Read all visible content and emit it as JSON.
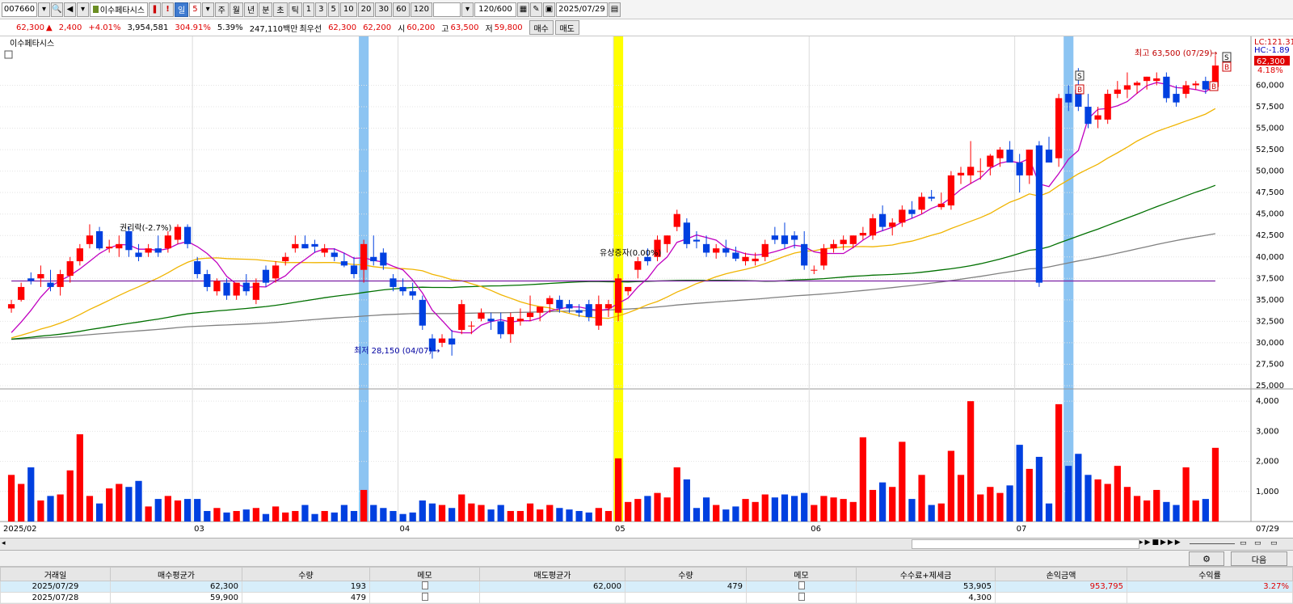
{
  "toolbar": {
    "code": "007660",
    "stock_name": "이수페타시스",
    "period_tabs": [
      "일",
      "주",
      "월",
      "년",
      "분",
      "초",
      "틱"
    ],
    "period_selected": "5",
    "intervals": [
      "1",
      "3",
      "5",
      "10",
      "20",
      "30",
      "60",
      "120"
    ],
    "count": "120/600",
    "date": "2025/07/29"
  },
  "info": {
    "price": "62,300",
    "change_arrow": "▲",
    "change": "2,400",
    "change_pct": "+4.01%",
    "volume": "3,954,581",
    "volume_pct": "304.91%",
    "turnover_pct": "5.39%",
    "amount": "247,110백만",
    "best_label": "최우선",
    "best_ask": "62,300",
    "best_bid": "62,200",
    "open_label": "시",
    "open": "60,200",
    "high_label": "고",
    "high": "63,500",
    "low_label": "저",
    "low": "59,800",
    "buy_button": "매수",
    "sell_button": "매도"
  },
  "chart": {
    "legend_title": "이수페타시스",
    "lc_label": "LC:121.31",
    "hc_label": "HC:-1.89",
    "current_price_tag": "62,300",
    "current_pct": "4.18%",
    "annotations": {
      "high": "최고 63,500 (07/29)",
      "low": "최저 28,150 (04/07)",
      "rights_issue": "유상증자(0.00%)",
      "ex_rights": "권리락(-2.7%)"
    },
    "x_labels": [
      "2025/02",
      "03",
      "04",
      "05",
      "06",
      "07",
      "07/29"
    ],
    "price_ticks": [
      "60,000",
      "57,500",
      "55,000",
      "52,500",
      "50,000",
      "47,500",
      "45,000",
      "42,500",
      "40,000",
      "37,500",
      "35,000",
      "32,500",
      "30,000",
      "27,500",
      "25,000"
    ],
    "volume_ticks": [
      "4,000",
      "3,000",
      "2,000",
      "1,000"
    ]
  },
  "chart_data": {
    "type": "candlestick",
    "price_range": [
      25000,
      64000
    ],
    "volume_range": [
      0,
      4300
    ],
    "candles": [
      {
        "o": 34000,
        "h": 35000,
        "l": 33500,
        "c": 34500,
        "v": 1550
      },
      {
        "o": 35000,
        "h": 37000,
        "l": 34800,
        "c": 36500,
        "v": 1250
      },
      {
        "o": 37500,
        "h": 38200,
        "l": 36800,
        "c": 37200,
        "v": 1800
      },
      {
        "o": 37500,
        "h": 39000,
        "l": 36500,
        "c": 38000,
        "v": 700
      },
      {
        "o": 37000,
        "h": 38500,
        "l": 36000,
        "c": 36500,
        "v": 850
      },
      {
        "o": 36500,
        "h": 38500,
        "l": 35500,
        "c": 38000,
        "v": 900
      },
      {
        "o": 37800,
        "h": 40000,
        "l": 37000,
        "c": 39500,
        "v": 1700
      },
      {
        "o": 39500,
        "h": 41500,
        "l": 39000,
        "c": 41000,
        "v": 2900
      },
      {
        "o": 41500,
        "h": 43800,
        "l": 41000,
        "c": 42500,
        "v": 850
      },
      {
        "o": 43000,
        "h": 43500,
        "l": 40800,
        "c": 41000,
        "v": 600
      },
      {
        "o": 41000,
        "h": 42000,
        "l": 40500,
        "c": 41200,
        "v": 1100
      },
      {
        "o": 41000,
        "h": 42500,
        "l": 40000,
        "c": 41500,
        "v": 1250
      },
      {
        "o": 43000,
        "h": 43500,
        "l": 40000,
        "c": 40800,
        "v": 1150
      },
      {
        "o": 40500,
        "h": 41500,
        "l": 39500,
        "c": 40000,
        "v": 1350
      },
      {
        "o": 40500,
        "h": 41500,
        "l": 40000,
        "c": 41000,
        "v": 500
      },
      {
        "o": 41000,
        "h": 42500,
        "l": 40000,
        "c": 40500,
        "v": 750
      },
      {
        "o": 41000,
        "h": 43000,
        "l": 40500,
        "c": 42500,
        "v": 850
      },
      {
        "o": 42000,
        "h": 43800,
        "l": 41500,
        "c": 43500,
        "v": 700
      },
      {
        "o": 43500,
        "h": 43800,
        "l": 41000,
        "c": 41500,
        "v": 750
      },
      {
        "o": 39500,
        "h": 40000,
        "l": 37500,
        "c": 38000,
        "v": 750
      },
      {
        "o": 38000,
        "h": 38500,
        "l": 36000,
        "c": 36500,
        "v": 350
      },
      {
        "o": 36000,
        "h": 37500,
        "l": 35500,
        "c": 37200,
        "v": 450
      },
      {
        "o": 37000,
        "h": 37500,
        "l": 35000,
        "c": 35500,
        "v": 300
      },
      {
        "o": 35500,
        "h": 37000,
        "l": 35000,
        "c": 37000,
        "v": 350
      },
      {
        "o": 37000,
        "h": 38000,
        "l": 35500,
        "c": 36000,
        "v": 400
      },
      {
        "o": 35000,
        "h": 37500,
        "l": 34500,
        "c": 37000,
        "v": 450
      },
      {
        "o": 38500,
        "h": 39000,
        "l": 36500,
        "c": 37000,
        "v": 250
      },
      {
        "o": 37500,
        "h": 39500,
        "l": 37000,
        "c": 39000,
        "v": 500
      },
      {
        "o": 39500,
        "h": 40500,
        "l": 39000,
        "c": 40000,
        "v": 300
      },
      {
        "o": 41000,
        "h": 42500,
        "l": 40500,
        "c": 41500,
        "v": 350
      },
      {
        "o": 41500,
        "h": 42500,
        "l": 41000,
        "c": 41000,
        "v": 550
      },
      {
        "o": 41500,
        "h": 42000,
        "l": 40500,
        "c": 41200,
        "v": 250
      },
      {
        "o": 40500,
        "h": 41500,
        "l": 40000,
        "c": 41000,
        "v": 350
      },
      {
        "o": 40500,
        "h": 41000,
        "l": 39500,
        "c": 40000,
        "v": 300
      },
      {
        "o": 39500,
        "h": 40500,
        "l": 38800,
        "c": 39000,
        "v": 550
      },
      {
        "o": 39000,
        "h": 40000,
        "l": 37500,
        "c": 38000,
        "v": 350
      },
      {
        "o": 38500,
        "h": 42000,
        "l": 37000,
        "c": 41500,
        "v": 1050
      },
      {
        "o": 40000,
        "h": 42500,
        "l": 39000,
        "c": 39500,
        "v": 550
      },
      {
        "o": 40500,
        "h": 41000,
        "l": 38500,
        "c": 39000,
        "v": 450
      },
      {
        "o": 37500,
        "h": 38000,
        "l": 36000,
        "c": 36500,
        "v": 350
      },
      {
        "o": 36500,
        "h": 37500,
        "l": 35500,
        "c": 36000,
        "v": 250
      },
      {
        "o": 36000,
        "h": 37000,
        "l": 35000,
        "c": 35500,
        "v": 300
      },
      {
        "o": 35000,
        "h": 35500,
        "l": 31500,
        "c": 32000,
        "v": 700
      },
      {
        "o": 30500,
        "h": 31000,
        "l": 28150,
        "c": 29000,
        "v": 600
      },
      {
        "o": 30000,
        "h": 31000,
        "l": 29500,
        "c": 30500,
        "v": 550
      },
      {
        "o": 30500,
        "h": 31500,
        "l": 28500,
        "c": 29800,
        "v": 450
      },
      {
        "o": 31500,
        "h": 35000,
        "l": 31000,
        "c": 34500,
        "v": 900
      },
      {
        "o": 32000,
        "h": 32500,
        "l": 31000,
        "c": 32000,
        "v": 600
      },
      {
        "o": 32800,
        "h": 34000,
        "l": 32500,
        "c": 33500,
        "v": 550
      },
      {
        "o": 32800,
        "h": 33500,
        "l": 31500,
        "c": 32500,
        "v": 400
      },
      {
        "o": 32500,
        "h": 33500,
        "l": 30500,
        "c": 31000,
        "v": 550
      },
      {
        "o": 31000,
        "h": 33500,
        "l": 30000,
        "c": 33000,
        "v": 350
      },
      {
        "o": 32500,
        "h": 34000,
        "l": 32000,
        "c": 32800,
        "v": 350
      },
      {
        "o": 33000,
        "h": 35500,
        "l": 32500,
        "c": 33500,
        "v": 600
      },
      {
        "o": 33500,
        "h": 34000,
        "l": 32500,
        "c": 34200,
        "v": 400
      },
      {
        "o": 34500,
        "h": 35500,
        "l": 33500,
        "c": 35200,
        "v": 550
      },
      {
        "o": 35000,
        "h": 35500,
        "l": 33500,
        "c": 34000,
        "v": 450
      },
      {
        "o": 34500,
        "h": 35000,
        "l": 33500,
        "c": 34000,
        "v": 400
      },
      {
        "o": 33800,
        "h": 34500,
        "l": 33000,
        "c": 33500,
        "v": 350
      },
      {
        "o": 34500,
        "h": 35000,
        "l": 32500,
        "c": 33000,
        "v": 300
      },
      {
        "o": 32000,
        "h": 35500,
        "l": 31500,
        "c": 34500,
        "v": 450
      },
      {
        "o": 34000,
        "h": 35000,
        "l": 33000,
        "c": 34500,
        "v": 350
      },
      {
        "o": 33500,
        "h": 38000,
        "l": 32500,
        "c": 37500,
        "v": 2100
      },
      {
        "o": 36000,
        "h": 36500,
        "l": 35500,
        "c": 36500,
        "v": 650
      },
      {
        "o": 38500,
        "h": 40000,
        "l": 37500,
        "c": 39500,
        "v": 750
      },
      {
        "o": 40000,
        "h": 41000,
        "l": 39000,
        "c": 39500,
        "v": 850
      },
      {
        "o": 40000,
        "h": 42500,
        "l": 39500,
        "c": 42000,
        "v": 950
      },
      {
        "o": 41500,
        "h": 42500,
        "l": 40500,
        "c": 42500,
        "v": 800
      },
      {
        "o": 43500,
        "h": 45500,
        "l": 43000,
        "c": 45000,
        "v": 1800
      },
      {
        "o": 44000,
        "h": 44500,
        "l": 41000,
        "c": 41500,
        "v": 1400
      },
      {
        "o": 42000,
        "h": 43000,
        "l": 41000,
        "c": 41800,
        "v": 450
      },
      {
        "o": 41500,
        "h": 42500,
        "l": 40000,
        "c": 40500,
        "v": 800
      },
      {
        "o": 40500,
        "h": 41500,
        "l": 39800,
        "c": 41000,
        "v": 550
      },
      {
        "o": 41000,
        "h": 42000,
        "l": 40000,
        "c": 40500,
        "v": 400
      },
      {
        "o": 40500,
        "h": 41200,
        "l": 39500,
        "c": 39800,
        "v": 500
      },
      {
        "o": 39500,
        "h": 40500,
        "l": 39000,
        "c": 40000,
        "v": 750
      },
      {
        "o": 39500,
        "h": 40500,
        "l": 39000,
        "c": 39800,
        "v": 650
      },
      {
        "o": 40000,
        "h": 42000,
        "l": 39500,
        "c": 41500,
        "v": 900
      },
      {
        "o": 42500,
        "h": 43500,
        "l": 41500,
        "c": 42000,
        "v": 800
      },
      {
        "o": 42500,
        "h": 44000,
        "l": 41000,
        "c": 41500,
        "v": 900
      },
      {
        "o": 42500,
        "h": 43000,
        "l": 41000,
        "c": 42000,
        "v": 850
      },
      {
        "o": 41500,
        "h": 43000,
        "l": 38500,
        "c": 39000,
        "v": 950
      },
      {
        "o": 38500,
        "h": 39000,
        "l": 38000,
        "c": 38500,
        "v": 550
      },
      {
        "o": 39000,
        "h": 41500,
        "l": 38500,
        "c": 41000,
        "v": 850
      },
      {
        "o": 41000,
        "h": 42000,
        "l": 40500,
        "c": 41500,
        "v": 800
      },
      {
        "o": 41500,
        "h": 42500,
        "l": 40800,
        "c": 42000,
        "v": 750
      },
      {
        "o": 41500,
        "h": 42500,
        "l": 41000,
        "c": 42500,
        "v": 650
      },
      {
        "o": 42500,
        "h": 43500,
        "l": 42000,
        "c": 42800,
        "v": 2800
      },
      {
        "o": 42500,
        "h": 45000,
        "l": 42000,
        "c": 44500,
        "v": 1050
      },
      {
        "o": 45000,
        "h": 46000,
        "l": 43000,
        "c": 43500,
        "v": 1300
      },
      {
        "o": 43500,
        "h": 44500,
        "l": 42500,
        "c": 44000,
        "v": 1150
      },
      {
        "o": 44000,
        "h": 46000,
        "l": 43500,
        "c": 45500,
        "v": 2650
      },
      {
        "o": 45500,
        "h": 46500,
        "l": 44500,
        "c": 45000,
        "v": 750
      },
      {
        "o": 45500,
        "h": 47500,
        "l": 45000,
        "c": 47000,
        "v": 1550
      },
      {
        "o": 47000,
        "h": 47800,
        "l": 46500,
        "c": 46800,
        "v": 550
      },
      {
        "o": 45800,
        "h": 47500,
        "l": 45500,
        "c": 46200,
        "v": 600
      },
      {
        "o": 46000,
        "h": 50000,
        "l": 45500,
        "c": 49500,
        "v": 2350
      },
      {
        "o": 49500,
        "h": 50500,
        "l": 48500,
        "c": 49800,
        "v": 1550
      },
      {
        "o": 49500,
        "h": 53500,
        "l": 48500,
        "c": 50500,
        "v": 4000
      },
      {
        "o": 50000,
        "h": 51500,
        "l": 49000,
        "c": 50000,
        "v": 900
      },
      {
        "o": 50500,
        "h": 52000,
        "l": 49500,
        "c": 51800,
        "v": 1150
      },
      {
        "o": 51500,
        "h": 52800,
        "l": 50500,
        "c": 52500,
        "v": 950
      },
      {
        "o": 52500,
        "h": 53500,
        "l": 51500,
        "c": 51000,
        "v": 1200
      },
      {
        "o": 51000,
        "h": 52000,
        "l": 47500,
        "c": 49500,
        "v": 2550
      },
      {
        "o": 49500,
        "h": 52500,
        "l": 48500,
        "c": 52500,
        "v": 1750
      },
      {
        "o": 53000,
        "h": 53500,
        "l": 36500,
        "c": 37000,
        "v": 2150
      },
      {
        "o": 52500,
        "h": 54000,
        "l": 51500,
        "c": 51000,
        "v": 600
      },
      {
        "o": 51500,
        "h": 59000,
        "l": 50500,
        "c": 58500,
        "v": 3900
      },
      {
        "o": 59000,
        "h": 60000,
        "l": 57000,
        "c": 58000,
        "v": 1850
      },
      {
        "o": 59500,
        "h": 62000,
        "l": 57000,
        "c": 57500,
        "v": 2250
      },
      {
        "o": 57500,
        "h": 59000,
        "l": 55000,
        "c": 55500,
        "v": 1550
      },
      {
        "o": 56000,
        "h": 57500,
        "l": 55000,
        "c": 56500,
        "v": 1400
      },
      {
        "o": 56000,
        "h": 59500,
        "l": 55500,
        "c": 59000,
        "v": 1250
      },
      {
        "o": 59000,
        "h": 60500,
        "l": 58500,
        "c": 59500,
        "v": 1850
      },
      {
        "o": 59500,
        "h": 61500,
        "l": 58500,
        "c": 60000,
        "v": 1150
      },
      {
        "o": 60000,
        "h": 60500,
        "l": 59000,
        "c": 60300,
        "v": 850
      },
      {
        "o": 60500,
        "h": 61000,
        "l": 59500,
        "c": 61000,
        "v": 700
      },
      {
        "o": 60500,
        "h": 61500,
        "l": 60000,
        "c": 60800,
        "v": 1050
      },
      {
        "o": 61000,
        "h": 61500,
        "l": 58000,
        "c": 58500,
        "v": 650
      },
      {
        "o": 59000,
        "h": 60000,
        "l": 57500,
        "c": 58000,
        "v": 550
      },
      {
        "o": 59000,
        "h": 60500,
        "l": 58500,
        "c": 60000,
        "v": 1800
      },
      {
        "o": 60000,
        "h": 60500,
        "l": 59500,
        "c": 60200,
        "v": 700
      },
      {
        "o": 60500,
        "h": 61000,
        "l": 59000,
        "c": 59500,
        "v": 750
      },
      {
        "o": 59800,
        "h": 63500,
        "l": 59800,
        "c": 62300,
        "v": 2450
      }
    ],
    "ma5_color": "#c000c0",
    "ma20_color": "#f0b400",
    "ma60_color": "#007000",
    "ma120_color": "#808080",
    "ma240_color": "#7b1fa2",
    "up_color": "#ff0000",
    "down_color": "#0040e0",
    "highlight_blue": "#8cc4f2",
    "highlight_yellow": "#ffff00"
  },
  "table": {
    "next_button": "다음",
    "headers": [
      "거래일",
      "매수평균가",
      "수량",
      "메모",
      "매도평균가",
      "수량",
      "메모",
      "수수료+제세금",
      "손익금액",
      "수익률"
    ],
    "rows": [
      {
        "date": "2025/07/29",
        "buy_avg": "62,300",
        "buy_qty": "193",
        "sell_avg": "62,000",
        "sell_qty": "479",
        "fee": "53,905",
        "pnl": "953,795",
        "rate": "3.27%"
      },
      {
        "date": "2025/07/28",
        "buy_avg": "59,900",
        "buy_qty": "479",
        "sell_avg": "",
        "sell_qty": "",
        "fee": "4,300",
        "pnl": "",
        "rate": ""
      }
    ]
  }
}
